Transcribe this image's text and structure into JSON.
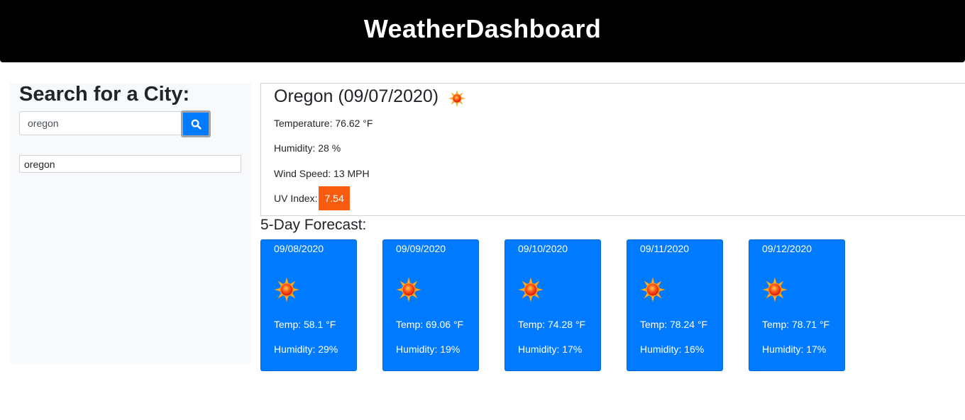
{
  "header": {
    "title": "WeatherDashboard"
  },
  "sidebar": {
    "heading": "Search for a City:",
    "search_value": "oregon",
    "search_button_icon": "search-icon",
    "history": [
      "oregon"
    ]
  },
  "current": {
    "title": "Oregon (09/07/2020)",
    "icon": "sun-icon",
    "temperature": "Temperature: 76.62 °F",
    "humidity": "Humidity: 28 %",
    "wind": "Wind Speed: 13 MPH",
    "uv_label": "UV Index:",
    "uv_value": "7.54"
  },
  "forecast": {
    "title": "5-Day Forecast:",
    "days": [
      {
        "date": "09/08/2020",
        "icon": "sun-icon",
        "temp": "Temp: 58.1 °F",
        "humidity": "Humidity: 29%"
      },
      {
        "date": "09/09/2020",
        "icon": "sun-icon",
        "temp": "Temp: 69.06 °F",
        "humidity": "Humidity: 19%"
      },
      {
        "date": "09/10/2020",
        "icon": "sun-icon",
        "temp": "Temp: 74.28 °F",
        "humidity": "Humidity: 17%"
      },
      {
        "date": "09/11/2020",
        "icon": "sun-icon",
        "temp": "Temp: 78.24 °F",
        "humidity": "Humidity: 16%"
      },
      {
        "date": "09/12/2020",
        "icon": "sun-icon",
        "temp": "Temp: 78.71 °F",
        "humidity": "Humidity: 17%"
      }
    ]
  },
  "colors": {
    "header_bg": "#000000",
    "accent": "#007bff",
    "uv_high": "#f85d0f",
    "sidebar_bg": "#f8f9fa"
  }
}
